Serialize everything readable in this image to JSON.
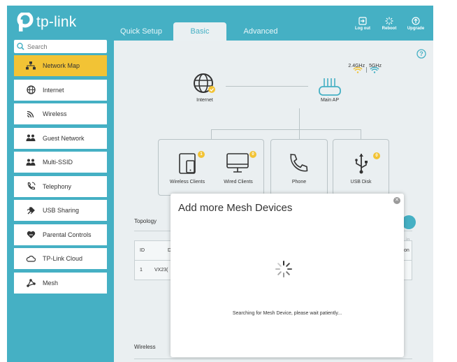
{
  "header": {
    "logo_text": "tp-link",
    "tabs": [
      {
        "label": "Quick Setup"
      },
      {
        "label": "Basic"
      },
      {
        "label": "Advanced"
      }
    ],
    "actions": [
      {
        "label": "Log out",
        "icon": "logout-icon"
      },
      {
        "label": "Reboot",
        "icon": "reboot-icon"
      },
      {
        "label": "Upgrade",
        "icon": "upgrade-icon"
      }
    ]
  },
  "sidebar": {
    "search_placeholder": "Search",
    "items": [
      {
        "label": "Network Map",
        "icon": "network-map-icon",
        "active": true
      },
      {
        "label": "Internet",
        "icon": "globe-icon"
      },
      {
        "label": "Wireless",
        "icon": "wifi-icon"
      },
      {
        "label": "Guest Network",
        "icon": "guest-users-icon"
      },
      {
        "label": "Multi-SSID",
        "icon": "multi-ssid-icon"
      },
      {
        "label": "Telephony",
        "icon": "telephony-icon"
      },
      {
        "label": "USB Sharing",
        "icon": "usb-sharing-icon"
      },
      {
        "label": "Parental Controls",
        "icon": "parental-heart-icon"
      },
      {
        "label": "TP-Link Cloud",
        "icon": "cloud-icon"
      },
      {
        "label": "Mesh",
        "icon": "mesh-icon"
      }
    ]
  },
  "network_map": {
    "internet_label": "Internet",
    "main_ap_label": "Main AP",
    "band_24": "2.4GHz",
    "band_5": "5GHz",
    "devices": [
      {
        "label": "Wireless Clients",
        "count": "1"
      },
      {
        "label": "Wired Clients",
        "count": "0"
      },
      {
        "label": "Phone"
      },
      {
        "label": "USB Disk",
        "count": "0"
      }
    ]
  },
  "topology": {
    "title": "Topology",
    "headers": [
      "ID",
      "D",
      "on"
    ],
    "rows": [
      {
        "id": "1",
        "device": "VX23("
      }
    ],
    "right_text": "in"
  },
  "wireless_title": "Wireless",
  "modal": {
    "title": "Add more Mesh Devices",
    "message": "Searching for Mesh Device, please wait patiently..."
  },
  "colors": {
    "brand_teal": "#45b0c4",
    "accent_yellow": "#f2c335",
    "panel": "#eaeff1"
  }
}
